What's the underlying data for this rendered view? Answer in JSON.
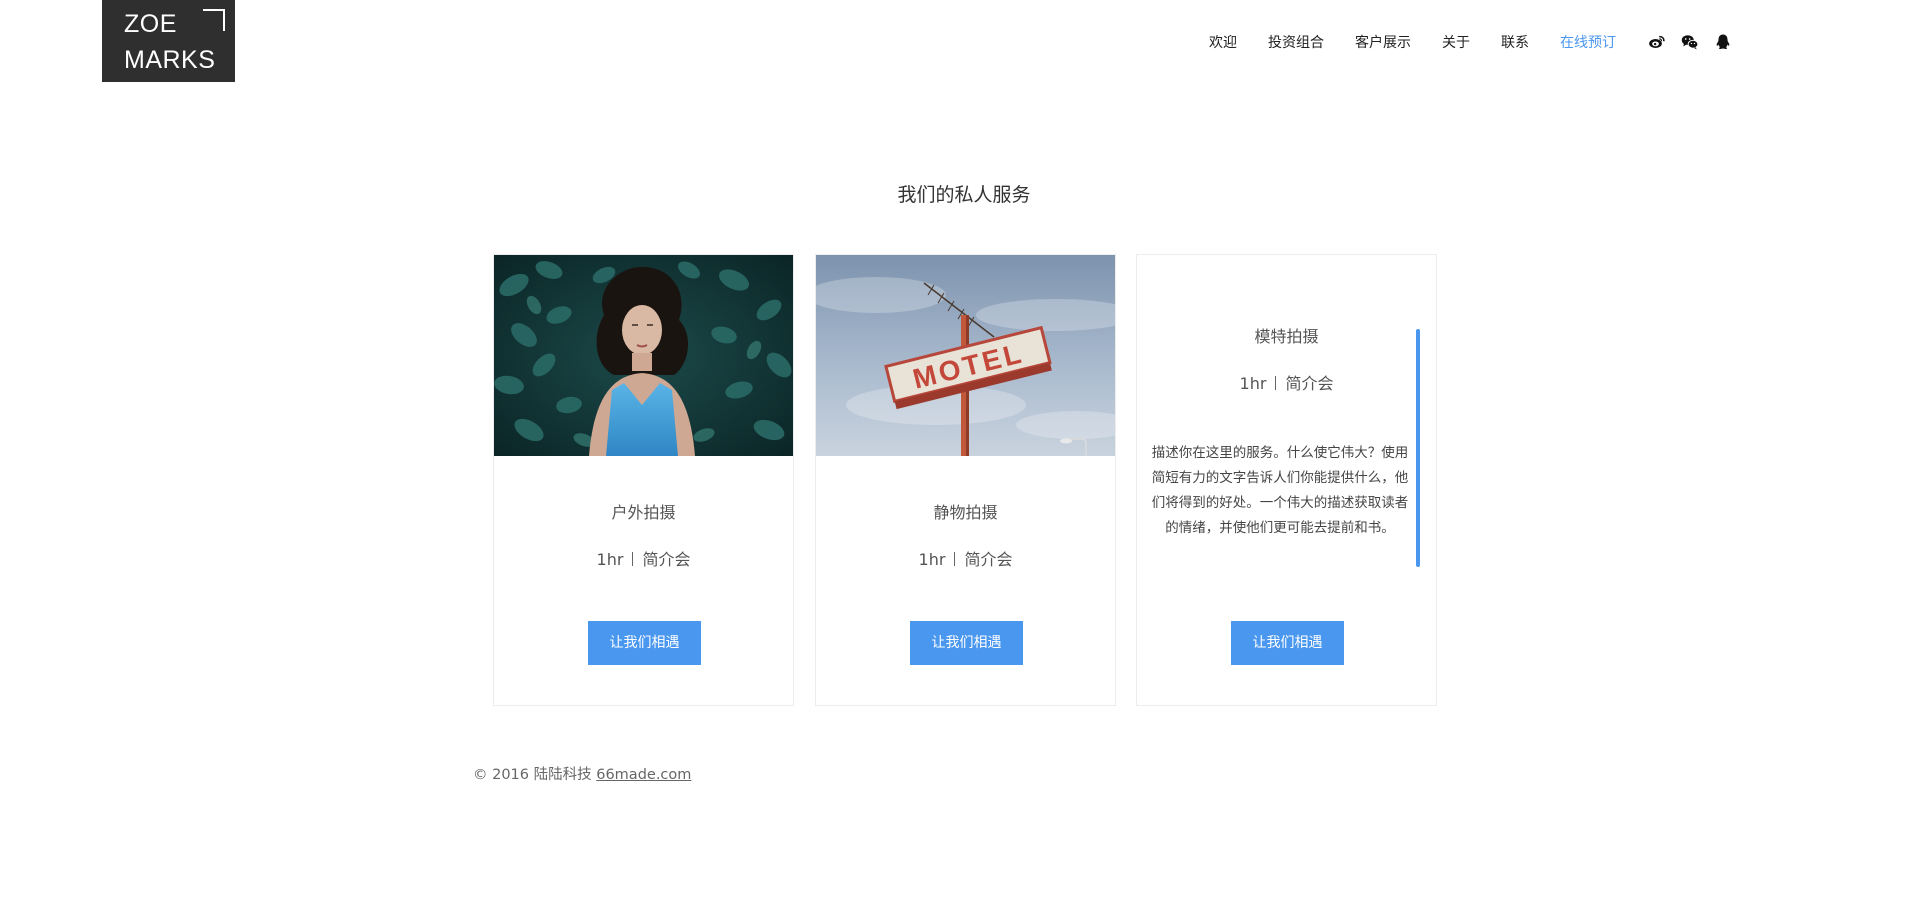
{
  "logo": {
    "line1": "ZOE",
    "line2": "MARKS"
  },
  "nav": {
    "items": [
      {
        "label": "欢迎",
        "active": false
      },
      {
        "label": "投资组合",
        "active": false
      },
      {
        "label": "客户展示",
        "active": false
      },
      {
        "label": "关于",
        "active": false
      },
      {
        "label": "联系",
        "active": false
      },
      {
        "label": "在线预订",
        "active": true
      }
    ],
    "social_icons": [
      "weibo-icon",
      "wechat-icon",
      "qq-icon"
    ]
  },
  "section": {
    "title": "我们的私人服务"
  },
  "cards": [
    {
      "title": "户外拍摄",
      "duration": "1hr",
      "meeting": "简介会",
      "button": "让我们相遇",
      "image": "woman-lying-in-leaves-photo"
    },
    {
      "title": "静物拍摄",
      "duration": "1hr",
      "meeting": "简介会",
      "button": "让我们相遇",
      "image": "motel-sign-photo",
      "image_text": "MOTEL"
    },
    {
      "title": "模特拍摄",
      "duration": "1hr",
      "meeting": "简介会",
      "button": "让我们相遇",
      "description": "描述你在这里的服务。什么使它伟大？使用简短有力的文字告诉人们你能提供什么，他们将得到的好处。一个伟大的描述获取读者的情绪，并使他们更可能去提前和书。"
    }
  ],
  "footer": {
    "copyright": "© 2016 陆陆科技",
    "link_text": "66made.com"
  },
  "colors": {
    "accent": "#4a97f0",
    "logo_bg": "#2f2f2f",
    "text": "#333333"
  }
}
